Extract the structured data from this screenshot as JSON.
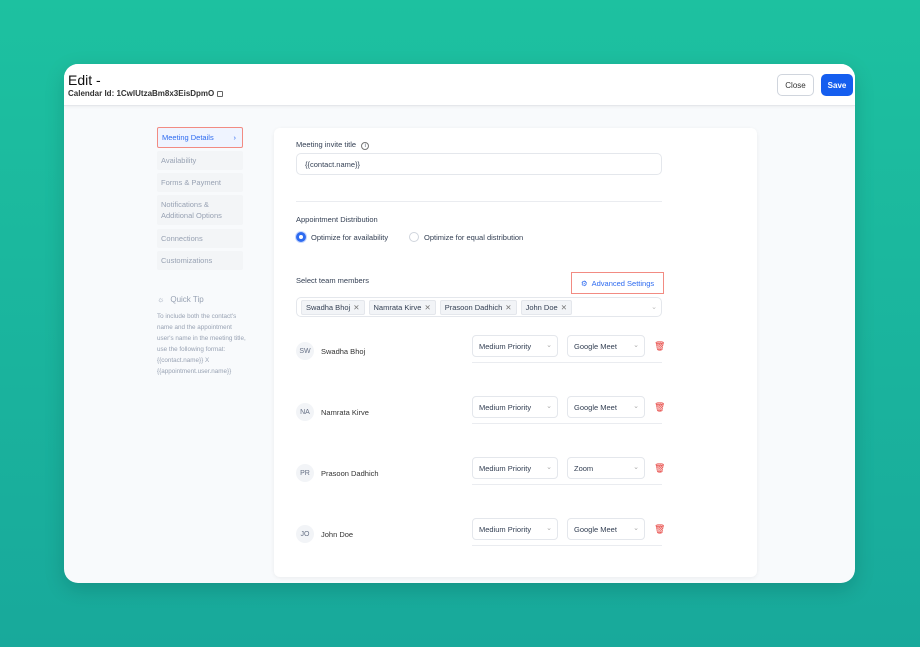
{
  "header": {
    "title": "Edit -",
    "calendar_id": "Calendar Id: 1CwlUtzaBm8x3EisDpmO",
    "close_label": "Close",
    "save_label": "Save"
  },
  "sidebar": {
    "items": [
      {
        "label": "Meeting Details"
      },
      {
        "label": "Availability"
      },
      {
        "label": "Forms & Payment"
      },
      {
        "label": "Notifications & Additional Options"
      },
      {
        "label": "Connections"
      },
      {
        "label": "Customizations"
      }
    ],
    "quick_tip": {
      "title": "Quick Tip",
      "text": "To include both the contact's name and the appointment user's name in the meeting title, use the following format: {{contact.name}} X {{appointment.user.name}}"
    }
  },
  "form": {
    "invite_title_label": "Meeting invite title",
    "invite_title_value": "{{contact.name}}",
    "distribution_label": "Appointment Distribution",
    "option_availability": "Optimize for availability",
    "option_equal": "Optimize for equal distribution",
    "selected_option": "availability",
    "team_label": "Select team members",
    "advanced_settings": "Advanced Settings",
    "tags": [
      "Swadha Bhoj",
      "Namrata Kirve",
      "Prasoon Dadhich",
      "John Doe"
    ],
    "members": [
      {
        "initials": "SW",
        "name": "Swadha Bhoj",
        "priority": "Medium Priority",
        "location": "Google Meet"
      },
      {
        "initials": "NA",
        "name": "Namrata Kirve",
        "priority": "Medium Priority",
        "location": "Google Meet"
      },
      {
        "initials": "PR",
        "name": "Prasoon Dadhich",
        "priority": "Medium Priority",
        "location": "Zoom"
      },
      {
        "initials": "JO",
        "name": "John Doe",
        "priority": "Medium Priority",
        "location": "Google Meet"
      }
    ]
  }
}
